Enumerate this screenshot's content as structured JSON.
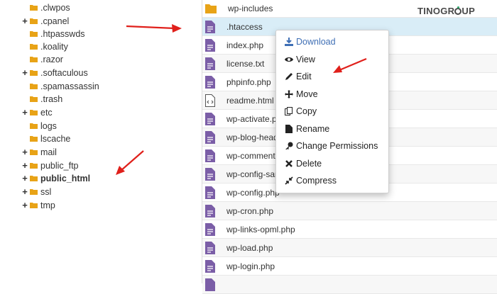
{
  "tree": {
    "items": [
      {
        "label": ".clwpos",
        "toggle": ""
      },
      {
        "label": ".cpanel",
        "toggle": "+"
      },
      {
        "label": ".htpasswds",
        "toggle": ""
      },
      {
        "label": ".koality",
        "toggle": ""
      },
      {
        "label": ".razor",
        "toggle": ""
      },
      {
        "label": ".softaculous",
        "toggle": "+"
      },
      {
        "label": ".spamassassin",
        "toggle": ""
      },
      {
        "label": ".trash",
        "toggle": ""
      },
      {
        "label": "etc",
        "toggle": "+"
      },
      {
        "label": "logs",
        "toggle": ""
      },
      {
        "label": "lscache",
        "toggle": ""
      },
      {
        "label": "mail",
        "toggle": "+"
      },
      {
        "label": "public_ftp",
        "toggle": "+"
      },
      {
        "label": "public_html",
        "toggle": "+"
      },
      {
        "label": "ssl",
        "toggle": "+"
      },
      {
        "label": "tmp",
        "toggle": "+"
      }
    ]
  },
  "files": {
    "rows": [
      {
        "name": "wp-includes",
        "type": "folder"
      },
      {
        "name": ".htaccess",
        "type": "file"
      },
      {
        "name": "index.php",
        "type": "file"
      },
      {
        "name": "license.txt",
        "type": "file"
      },
      {
        "name": "phpinfo.php",
        "type": "file"
      },
      {
        "name": "readme.html",
        "type": "html"
      },
      {
        "name": "wp-activate.p",
        "type": "file"
      },
      {
        "name": "wp-blog-head",
        "type": "file"
      },
      {
        "name": "wp-comments-",
        "type": "file"
      },
      {
        "name": "wp-config-sar",
        "type": "file"
      },
      {
        "name": "wp-config.php",
        "type": "file"
      },
      {
        "name": "wp-cron.php",
        "type": "file"
      },
      {
        "name": "wp-links-opml.php",
        "type": "file"
      },
      {
        "name": "wp-load.php",
        "type": "file"
      },
      {
        "name": "wp-login.php",
        "type": "file"
      }
    ]
  },
  "context_menu": {
    "items": [
      {
        "label": "Download",
        "icon": "download-icon"
      },
      {
        "label": "View",
        "icon": "eye-icon"
      },
      {
        "label": "Edit",
        "icon": "pencil-icon"
      },
      {
        "label": "Move",
        "icon": "move-icon"
      },
      {
        "label": "Copy",
        "icon": "copy-icon"
      },
      {
        "label": "Rename",
        "icon": "file-icon"
      },
      {
        "label": "Change Permissions",
        "icon": "key-icon"
      },
      {
        "label": "Delete",
        "icon": "close-icon"
      },
      {
        "label": "Compress",
        "icon": "compress-icon"
      }
    ]
  },
  "logo": {
    "text_left": "TINO",
    "text_mid": "GR",
    "text_right": "UP"
  },
  "colors": {
    "folder": "#e8a317",
    "file_icon": "#7b5ea7",
    "accent": "#3f6fb5",
    "arrow": "#e0201b",
    "selected_row": "#d9edf7"
  }
}
